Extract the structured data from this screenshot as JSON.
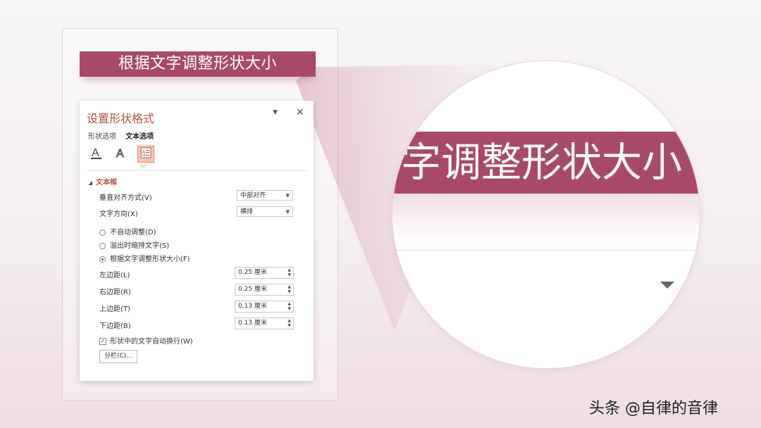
{
  "banner": {
    "text": "根据文字调整形状大小"
  },
  "panel": {
    "title": "设置形状格式",
    "tabs": [
      {
        "label": "形状选项"
      },
      {
        "label": "文本选项"
      }
    ],
    "icons": [
      "text-fill-icon",
      "text-effects-icon",
      "textbox-icon"
    ],
    "section": "文本框",
    "vertical_align": {
      "label": "垂直对齐方式(V)",
      "value": "中部对齐"
    },
    "text_direction": {
      "label": "文字方向(X)",
      "value": "横排"
    },
    "autofit": [
      {
        "label": "不自动调整(D)",
        "selected": false
      },
      {
        "label": "溢出时缩排文字(S)",
        "selected": false
      },
      {
        "label": "根据文字调整形状大小(F)",
        "selected": true
      }
    ],
    "margins": [
      {
        "label": "左边距(L)",
        "value": "0.25 厘米"
      },
      {
        "label": "右边距(R)",
        "value": "0.25 厘米"
      },
      {
        "label": "上边距(T)",
        "value": "0.13 厘米"
      },
      {
        "label": "下边距(B)",
        "value": "0.13 厘米"
      }
    ],
    "wrap_text": {
      "label": "形状中的文字自动换行(W)",
      "checked": true
    },
    "columns_button": "分栏(C)..."
  },
  "magnifier": {
    "text": "字调整形状大小"
  },
  "watermark": "头条 @自律的音律",
  "colors": {
    "accent": "#a8496b",
    "title": "#b5524a"
  }
}
